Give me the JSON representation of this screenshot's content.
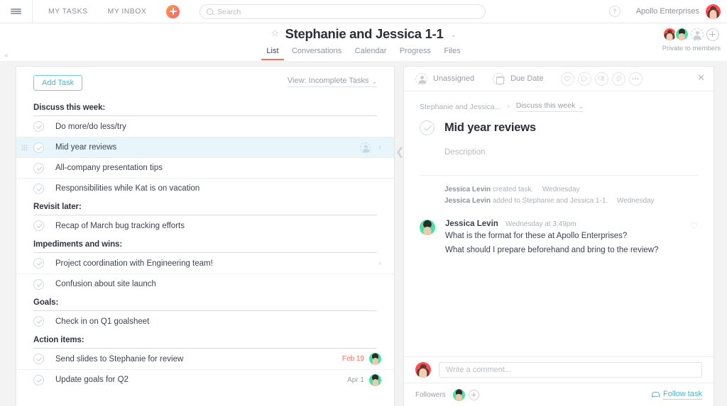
{
  "topbar": {
    "menu_icon": "hamburger-icon",
    "nav": [
      {
        "label": "MY TASKS"
      },
      {
        "label": "MY INBOX"
      }
    ],
    "add_button_icon": "plus-icon",
    "search": {
      "placeholder": "Search",
      "value": "",
      "icon": "search-icon"
    },
    "help_icon_label": "?",
    "org_name": "Apollo Enterprises",
    "user_avatar": "avatar-red"
  },
  "project": {
    "star_icon": "star-outline-icon",
    "title": "Stephanie and Jessica 1-1",
    "title_caret": "⌄",
    "tabs": [
      {
        "label": "List",
        "active": true
      },
      {
        "label": "Conversations",
        "active": false
      },
      {
        "label": "Calendar",
        "active": false
      },
      {
        "label": "Progress",
        "active": false
      },
      {
        "label": "Files",
        "active": false
      }
    ],
    "privacy_label": "Private to members",
    "accent_tab_color": "#fa6b62"
  },
  "list": {
    "add_task_label": "Add Task",
    "view_label": "View: Incomplete Tasks",
    "view_caret": "⌄",
    "sections": [
      {
        "title": "Discuss this week:",
        "tasks": [
          {
            "name": "Do more/do less/try",
            "date": "",
            "selected": false,
            "assignee": ""
          },
          {
            "name": "Mid year reviews",
            "date": "",
            "selected": true,
            "assignee": ""
          },
          {
            "name": "All-company presentation tips",
            "date": "",
            "selected": false,
            "assignee": ""
          },
          {
            "name": "Responsibilities while Kat is on vacation",
            "date": "",
            "selected": false,
            "assignee": ""
          }
        ]
      },
      {
        "title": "Revisit later:",
        "tasks": [
          {
            "name": "Recap of March bug tracking efforts",
            "date": "",
            "selected": false,
            "assignee": ""
          }
        ]
      },
      {
        "title": "Impediments and wins:",
        "tasks": [
          {
            "name": "Project coordination with Engineering team!",
            "date": "",
            "selected": false,
            "assignee": ""
          },
          {
            "name": "Confusion about site launch",
            "date": "",
            "selected": false,
            "assignee": ""
          }
        ]
      },
      {
        "title": "Goals:",
        "tasks": [
          {
            "name": "Check in on Q1 goalsheet",
            "date": "",
            "selected": false,
            "assignee": ""
          }
        ]
      },
      {
        "title": "Action items:",
        "tasks": [
          {
            "name": "Send slides to Stephanie for review",
            "date": "Feb 19",
            "overdue": true,
            "selected": false,
            "assignee": "avatar-green"
          },
          {
            "name": "Update goals for Q2",
            "date": "Apr 1",
            "overdue": false,
            "selected": false,
            "assignee": "avatar-green"
          }
        ]
      }
    ]
  },
  "detail": {
    "assignee_label": "Unassigned",
    "assignee_icon": "person-dashed-icon",
    "due_date_label": "Due Date",
    "due_date_icon": "calendar-dashed-icon",
    "action_icons": [
      "heart-icon",
      "tag-icon",
      "subtask-icon",
      "attachment-icon",
      "more-icon"
    ],
    "close_icon": "close-icon",
    "breadcrumb": {
      "project": "Stephanie and Jessica...",
      "separator": "›",
      "section": "Discuss this week",
      "section_caret": "⌄"
    },
    "task_title": "Mid year reviews",
    "description_placeholder": "Description",
    "activity": [
      {
        "actor": "Jessica Levin",
        "action": "created task.",
        "time": "Wednesday"
      },
      {
        "actor": "Jessica Levin",
        "action": "added to Stephanie and Jessica 1-1.",
        "time": "Wednesday"
      }
    ],
    "comments": [
      {
        "author": "Jessica Levin",
        "avatar": "avatar-green",
        "time": "Wednesday at 3:49pm",
        "line1": "What is the format for these at Apollo Enterprises?",
        "line2": "What should I prepare beforehand and bring to the review?",
        "like_icon": "heart-icon"
      }
    ],
    "comment_box": {
      "placeholder": "Write a comment...",
      "value": "",
      "avatar": "avatar-red"
    },
    "followers_label": "Followers",
    "follow_task_label": "Follow task",
    "follow_icon": "bell-icon",
    "link_color": "#3fb8d6"
  }
}
